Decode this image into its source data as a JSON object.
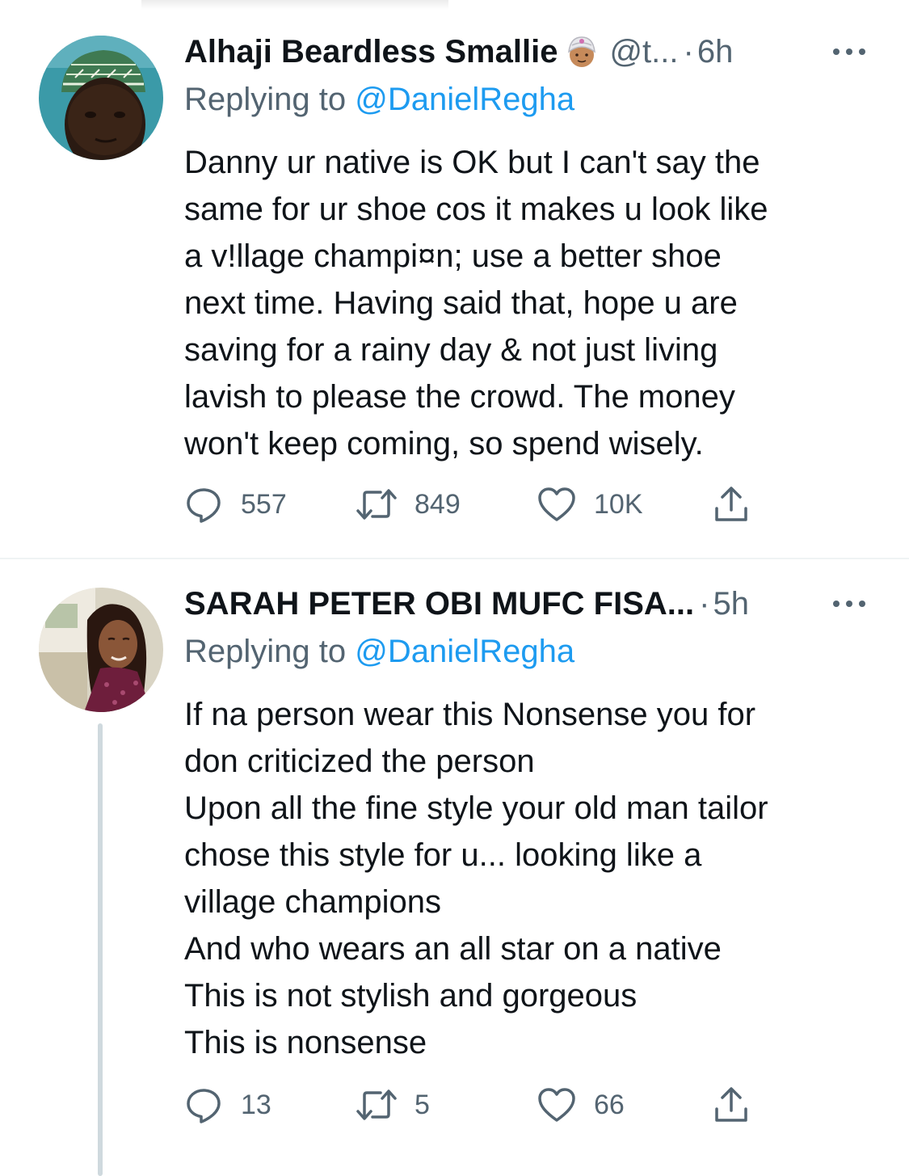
{
  "tweets": [
    {
      "display_name": "Alhaji Beardless Smallie",
      "name_emoji": "man-with-turban-emoji",
      "handle": "@t...",
      "separator": "·",
      "time": "6h",
      "replying_prefix": "Replying to",
      "replying_to": "@DanielRegha",
      "body_lines": [
        "Danny ur native is OK but I can't say the",
        "same for ur shoe cos it makes u look like",
        "a v!llage champi¤n; use a better shoe",
        "next time. Having said that, hope u are",
        "saving for a rainy day & not just living",
        "lavish to please the crowd. The money",
        "won't keep coming, so spend wisely."
      ],
      "replies": "557",
      "retweets": "849",
      "likes": "10K"
    },
    {
      "display_name": "SARAH PETER OBI MUFC FISA...",
      "separator": "·",
      "time": "5h",
      "replying_prefix": "Replying to",
      "replying_to": "@DanielRegha",
      "body_lines": [
        "If na person wear this Nonsense you for",
        "don criticized the person",
        "Upon all the fine style your old man tailor",
        "chose this style for u... looking like a",
        "village champions",
        "And who wears an all star on a native",
        "This is not stylish and gorgeous",
        "This is nonsense"
      ],
      "replies": "13",
      "retweets": "5",
      "likes": "66"
    }
  ],
  "icons": {
    "reply": "reply-icon",
    "retweet": "retweet-icon",
    "like": "heart-icon",
    "share": "share-icon",
    "more": "more-icon"
  },
  "colors": {
    "text": "#0f1419",
    "secondary": "#536471",
    "link": "#1d9bf0",
    "divider": "#eff3f4",
    "thread_line": "#cfd9de"
  }
}
